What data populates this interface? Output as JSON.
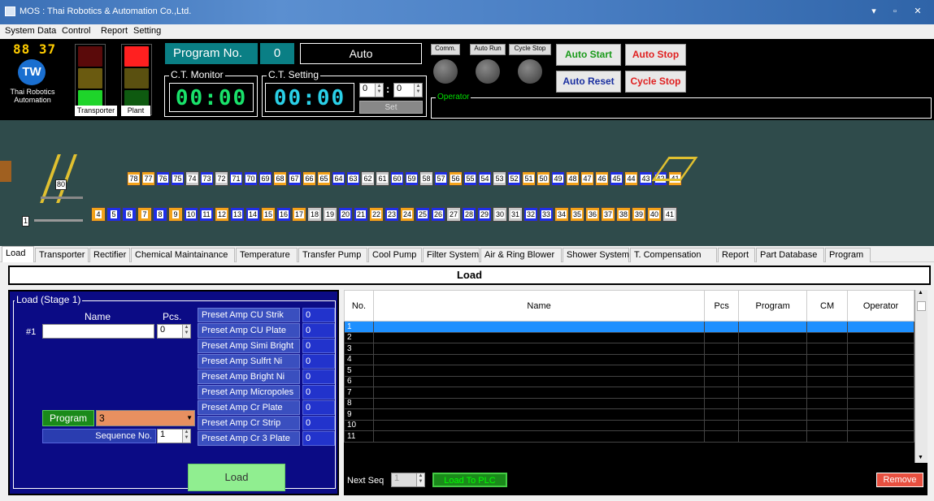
{
  "window": {
    "title": "MOS : Thai Robotics & Automation Co.,Ltd."
  },
  "menu": [
    "System",
    "Data",
    "Control",
    "Report",
    "Setting"
  ],
  "top": {
    "clock": "88 37",
    "logo_text": "TW",
    "company": "Thai Robotics Automation",
    "transporter_label": "Transporter",
    "plant_label": "Plant",
    "program_no_label": "Program No.",
    "program_no_value": "0",
    "mode": "Auto",
    "ct_monitor_label": "C.T. Monitor",
    "ct_monitor_value": "00:00",
    "ct_setting_label": "C.T. Setting",
    "ct_setting_value": "00:00",
    "ct_min": "0",
    "ct_sec": "0",
    "set_button": "Set",
    "comm_label": "Comm.",
    "auto_run_label": "Auto Run",
    "cycle_stop_label": "Cycle Stop",
    "auto_start": "Auto Start",
    "auto_stop": "Auto Stop",
    "auto_reset": "Auto Reset",
    "cycle_stop_btn": "Cycle Stop",
    "operator_label": "Operator",
    "colors": {
      "start_green": "#1a9a1a",
      "stop_red": "#e02020",
      "reset_blue": "#1a2fa0"
    }
  },
  "plant": {
    "back_row": [
      "78",
      "77",
      "76",
      "75",
      "74",
      "73",
      "72",
      "71",
      "70",
      "69",
      "68",
      "67",
      "66",
      "65",
      "64",
      "63",
      "62",
      "61",
      "60",
      "59",
      "58",
      "57",
      "56",
      "55",
      "54",
      "53",
      "52",
      "51",
      "50",
      "49",
      "48",
      "47",
      "46",
      "45",
      "44",
      "43",
      "42",
      "41"
    ],
    "front_row": [
      "4",
      "5",
      "6",
      "7",
      "8",
      "9",
      "10",
      "11",
      "12",
      "13",
      "14",
      "15",
      "16",
      "17",
      "18",
      "19",
      "20",
      "21",
      "22",
      "23",
      "24",
      "25",
      "26",
      "27",
      "28",
      "29",
      "30",
      "31",
      "32",
      "33",
      "34",
      "35",
      "36",
      "37",
      "38",
      "39",
      "40",
      "41"
    ],
    "transporter_labels": [
      "80",
      "1"
    ]
  },
  "tabs": [
    "Load",
    "Transporter",
    "Rectifier",
    "Chemical Maintainance",
    "Temperature",
    "Transfer Pump",
    "Cool Pump",
    "Filter System",
    "Air & Ring Blower",
    "Shower System",
    "T. Compensation",
    "Report",
    "Part Database",
    "Program"
  ],
  "load": {
    "header": "Load",
    "stage_title": "Load (Stage 1)",
    "name_label": "Name",
    "pcs_label": "Pcs.",
    "row_label": "#1",
    "name_value": "",
    "pcs_value": "0",
    "presets": [
      {
        "label": "Preset Amp CU Strik",
        "value": "0"
      },
      {
        "label": "Preset Amp CU Plate",
        "value": "0"
      },
      {
        "label": "Preset Amp Simi Bright",
        "value": "0"
      },
      {
        "label": "Preset Amp Sulfrt Ni",
        "value": "0"
      },
      {
        "label": "Preset Amp Bright Ni",
        "value": "0"
      },
      {
        "label": "Preset Amp Micropoles",
        "value": "0"
      },
      {
        "label": "Preset Amp Cr Plate",
        "value": "0"
      },
      {
        "label": "Preset Amp Cr Strip",
        "value": "0"
      },
      {
        "label": "Preset Amp Cr 3 Plate",
        "value": "0"
      }
    ],
    "program_label": "Program",
    "program_value": "3",
    "sequence_label": "Sequence No.",
    "sequence_value": "1",
    "load_button": "Load"
  },
  "grid": {
    "columns": [
      "No.",
      "Name",
      "Pcs",
      "Program",
      "CM",
      "Operator"
    ],
    "rows": [
      "1",
      "2",
      "3",
      "4",
      "5",
      "6",
      "7",
      "8",
      "9",
      "10",
      "11"
    ],
    "selected_row": "1",
    "next_seq_label": "Next Seq",
    "next_seq_value": "1",
    "load_to_plc": "Load To PLC",
    "remove": "Remove"
  }
}
